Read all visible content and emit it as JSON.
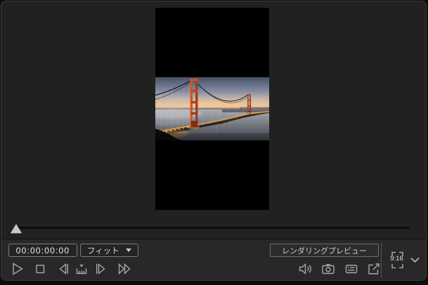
{
  "transport": {
    "timecode": "00:00:00:00",
    "display_zoom": "フィット",
    "render_preview": "レンダリングプレビュー",
    "aspect_ratio": "9:16"
  },
  "icons": {
    "playback": [
      "play-icon",
      "stop-icon",
      "previous-frame-icon",
      "seek-ruler-icon",
      "next-frame-icon",
      "fast-forward-icon"
    ],
    "utility": [
      "volume-icon",
      "snapshot-camera-icon",
      "display-options-icon",
      "undock-preview-icon"
    ],
    "aspect_selector": [
      "aspect-bracket-icon",
      "chevron-down-icon"
    ],
    "dropdown": "dropdown-arrow-icon",
    "scrubber": "playhead-marker"
  },
  "colors": {
    "panel_background": "#212121",
    "panel_border": "#3c3c3c",
    "controlbar_background": "#282828",
    "video_frame": "#000000",
    "icon_gray": "#a8a8a8",
    "text_light": "#ededed",
    "playhead": "#c8c8c8",
    "track": "#0c0c0c",
    "bridge_orange": "#c9512b",
    "deck_lights": "#ffc55e"
  }
}
